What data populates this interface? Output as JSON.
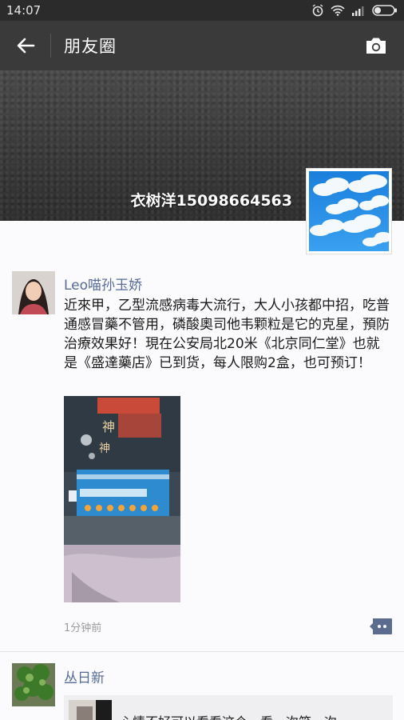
{
  "status_bar": {
    "time": "14:07"
  },
  "header": {
    "title": "朋友圈"
  },
  "cover": {
    "user_name": "衣树洋15098664563"
  },
  "posts": [
    {
      "name": "Leo喵孙玉娇",
      "text": "近來甲，乙型流感病毒大流行，大人小孩都中招，吃普通感冒藥不管用，磷酸奧司他韦颗粒是它的克星，預防治療效果好！現在公安局北20米《北京同仁堂》也就是《盛達藥店》已到货，每人限购2盒，也可预订！",
      "time": "1分钟前"
    },
    {
      "name": "丛日新",
      "shared_text": "心情不好可以看看这个，看一次笑一次"
    }
  ],
  "colors": {
    "name_link": "#576b95",
    "titlebar": "#3a3a3a",
    "status_bar": "#2b2b2b"
  },
  "icons": [
    "back-arrow",
    "camera",
    "alarm",
    "wifi",
    "signal",
    "battery",
    "comment-dots"
  ]
}
